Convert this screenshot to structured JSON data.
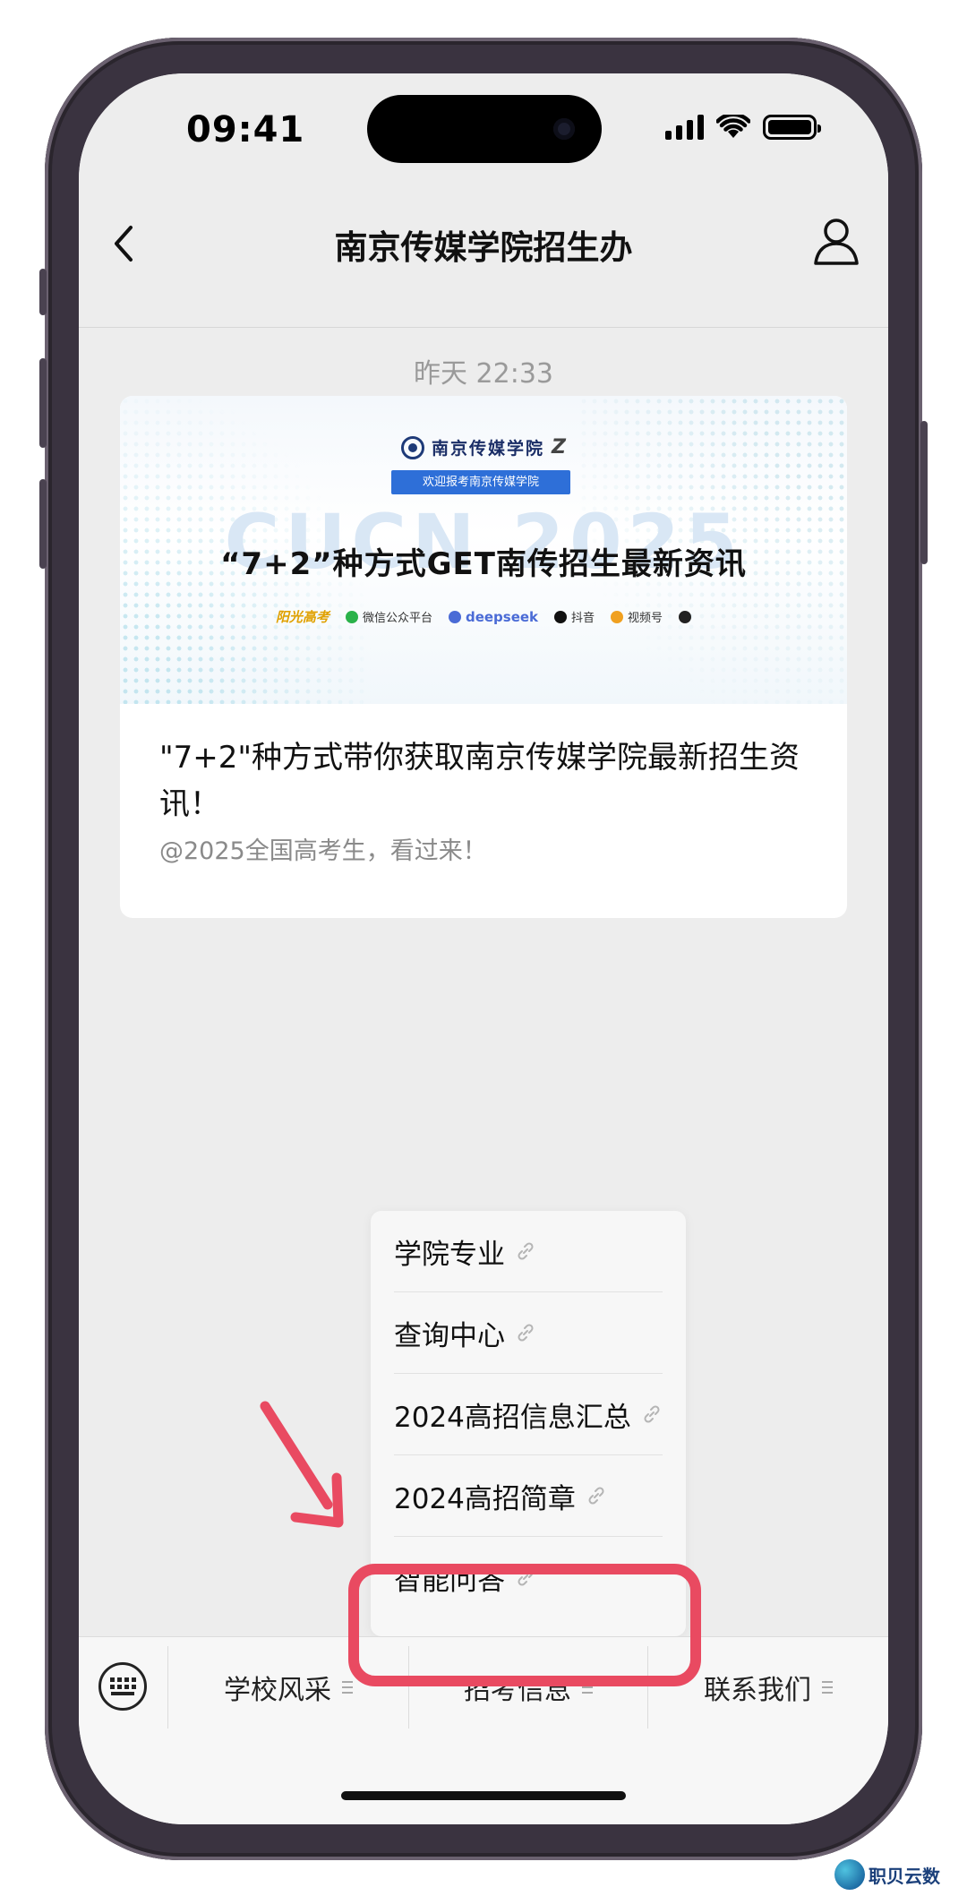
{
  "status_bar": {
    "time": "09:41"
  },
  "nav": {
    "title": "南京传媒学院招生办"
  },
  "chat": {
    "timestamp": "昨天 22:33",
    "article": {
      "banner": {
        "logo_text": "南京传媒学院",
        "welcome": "欢迎报考南京传媒学院",
        "background_text": "CUCN 2025",
        "headline": "“7+2”种方式GET南传招生最新资讯",
        "platforms": [
          "阳光高考",
          "微信公众平台",
          "deepseek",
          "抖音",
          "视频号"
        ]
      },
      "title": "\"7+2\"种方式带你获取南京传媒学院最新招生资讯！",
      "description": "@2025全国高考生，看过来！"
    }
  },
  "popup_menu": {
    "items": [
      {
        "label": "学院专业"
      },
      {
        "label": "查询中心"
      },
      {
        "label": "2024高招信息汇总"
      },
      {
        "label": "2024高招简章"
      },
      {
        "label": "智能问答"
      }
    ]
  },
  "bottom_bar": {
    "menus": [
      {
        "label": "学校风采"
      },
      {
        "label": "招考信息"
      },
      {
        "label": "联系我们"
      }
    ]
  },
  "annotation": {
    "highlight_color": "#e94a61"
  },
  "watermark": {
    "text": "职贝云数"
  }
}
